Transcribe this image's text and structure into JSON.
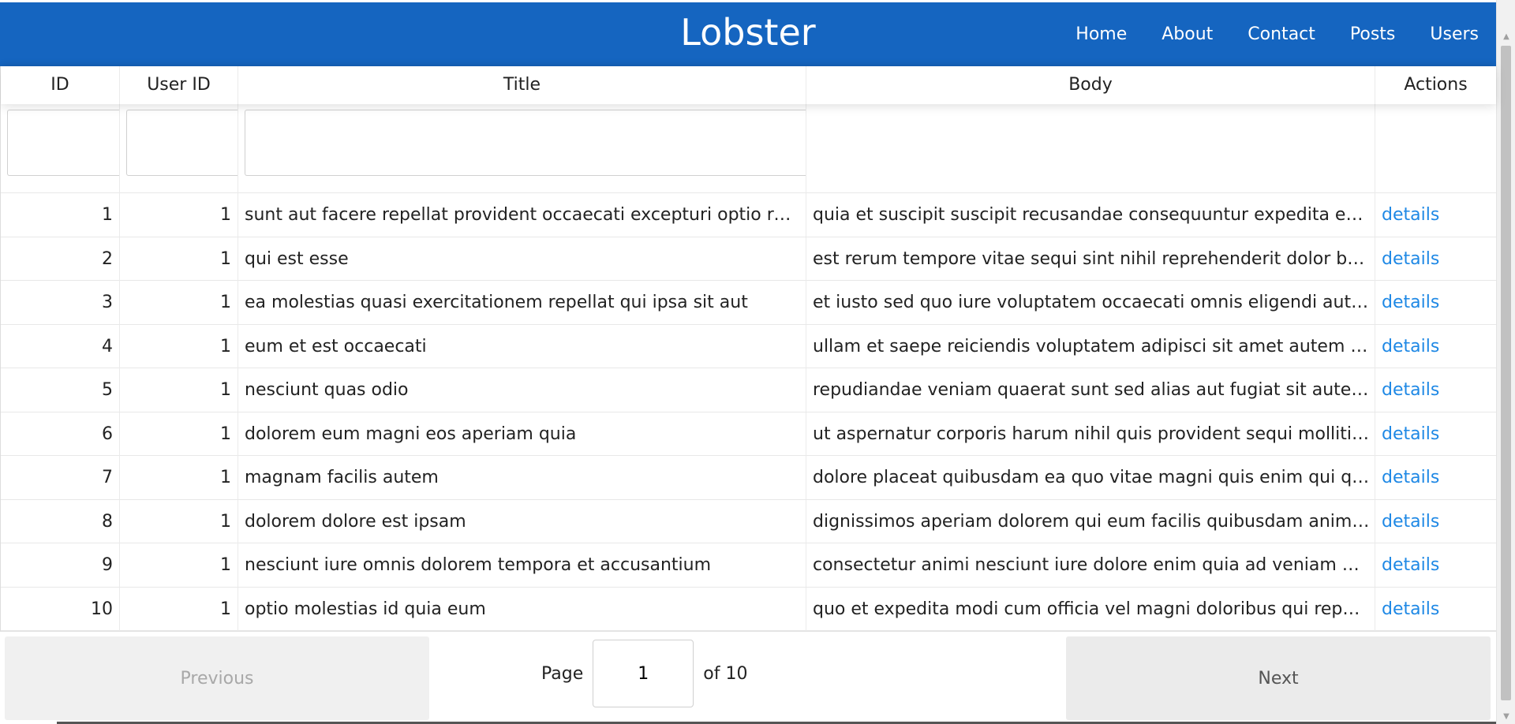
{
  "app": {
    "brand": "Lobster",
    "nav": [
      "Home",
      "About",
      "Contact",
      "Posts",
      "Users"
    ]
  },
  "table": {
    "columns": [
      "ID",
      "User ID",
      "Title",
      "Body",
      "Actions"
    ],
    "filters": {
      "id": "",
      "user_id": "",
      "title": ""
    },
    "rows": [
      {
        "id": "1",
        "user_id": "1",
        "title": "sunt aut facere repellat provident occaecati excepturi optio reprehen...",
        "body": "quia et suscipit suscipit recusandae consequuntur expedita et cum re...",
        "action": "details"
      },
      {
        "id": "2",
        "user_id": "1",
        "title": "qui est esse",
        "body": "est rerum tempore vitae sequi sint nihil reprehenderit dolor beatae e...",
        "action": "details"
      },
      {
        "id": "3",
        "user_id": "1",
        "title": "ea molestias quasi exercitationem repellat qui ipsa sit aut",
        "body": "et iusto sed quo iure voluptatem occaecati omnis eligendi aut ad vol...",
        "action": "details"
      },
      {
        "id": "4",
        "user_id": "1",
        "title": "eum et est occaecati",
        "body": "ullam et saepe reiciendis voluptatem adipisci sit amet autem assume...",
        "action": "details"
      },
      {
        "id": "5",
        "user_id": "1",
        "title": "nesciunt quas odio",
        "body": "repudiandae veniam quaerat sunt sed alias aut fugiat sit autem sed e...",
        "action": "details"
      },
      {
        "id": "6",
        "user_id": "1",
        "title": "dolorem eum magni eos aperiam quia",
        "body": "ut aspernatur corporis harum nihil quis provident sequi mollitia nobis...",
        "action": "details"
      },
      {
        "id": "7",
        "user_id": "1",
        "title": "magnam facilis autem",
        "body": "dolore placeat quibusdam ea quo vitae magni quis enim qui quis qu...",
        "action": "details"
      },
      {
        "id": "8",
        "user_id": "1",
        "title": "dolorem dolore est ipsam",
        "body": "dignissimos aperiam dolorem qui eum facilis quibusdam animi sint s...",
        "action": "details"
      },
      {
        "id": "9",
        "user_id": "1",
        "title": "nesciunt iure omnis dolorem tempora et accusantium",
        "body": "consectetur animi nesciunt iure dolore enim quia ad veniam autem u...",
        "action": "details"
      },
      {
        "id": "10",
        "user_id": "1",
        "title": "optio molestias id quia eum",
        "body": "quo et expedita modi cum officia vel magni doloribus qui repudianda...",
        "action": "details"
      }
    ]
  },
  "pagination": {
    "previous_label": "Previous",
    "next_label": "Next",
    "page_label": "Page",
    "current_page": "1",
    "of_label": "of 10"
  },
  "colors": {
    "header_bg": "#1565c0",
    "link": "#1e88e5"
  }
}
